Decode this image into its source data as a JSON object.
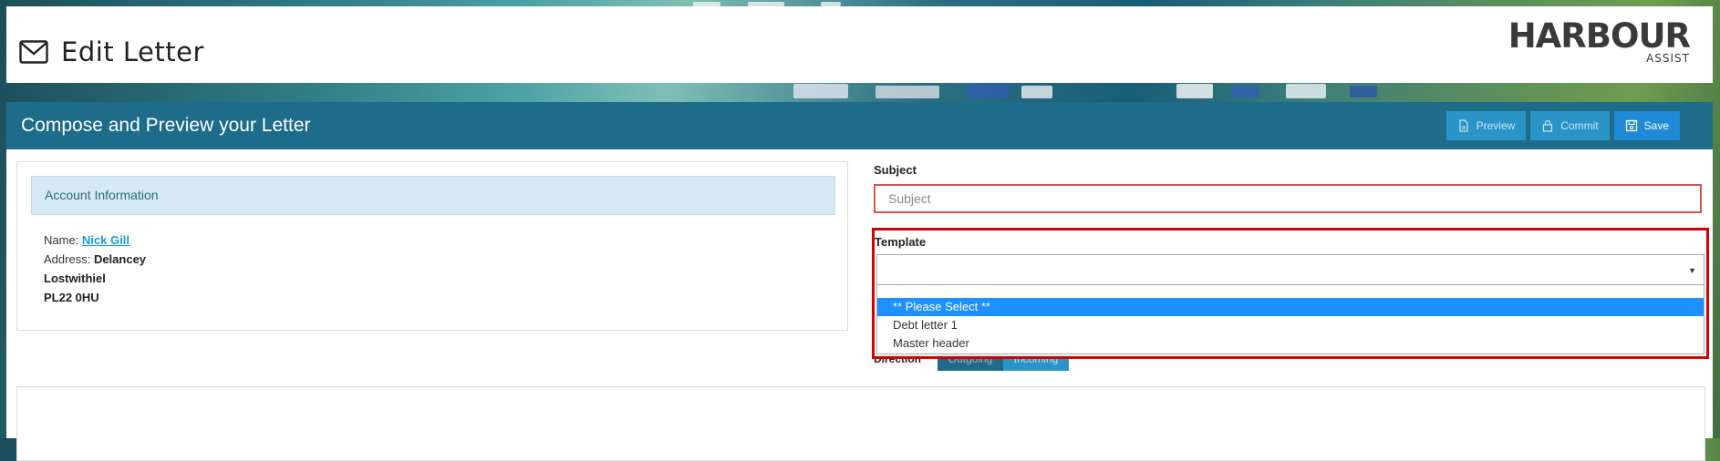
{
  "header": {
    "title": "Edit Letter",
    "logo_main": "HARBOUR",
    "logo_sub": "ASSIST"
  },
  "panel": {
    "title": "Compose and Preview your Letter",
    "buttons": {
      "preview": "Preview",
      "commit": "Commit",
      "save": "Save"
    }
  },
  "account": {
    "heading": "Account Information",
    "name_label": "Name:",
    "name_value": "Nick Gill",
    "address_label": "Address:",
    "address_line1": "Delancey",
    "address_line2": "Lostwithiel",
    "address_line3": "PL22 0HU"
  },
  "form": {
    "subject_label": "Subject",
    "subject_placeholder": "Subject",
    "subject_value": "",
    "template_label": "Template",
    "template_value": "",
    "template_options": [
      "** Please Select **",
      "Debt letter 1",
      "Master header"
    ],
    "template_highlighted": "** Please Select **",
    "direction_label": "Direction",
    "direction_options": [
      "Outgoing",
      "Incoming"
    ]
  },
  "colors": {
    "panel_bar": "#1e6b8a",
    "button_light": "#2a94c7",
    "button_save": "#1f8ad6",
    "error_border": "#d9534f",
    "highlight_frame": "#d60000",
    "option_selected": "#1e90ff",
    "link": "#1a9ad6"
  },
  "icons": {
    "title": "envelope-icon",
    "preview": "document-icon",
    "commit": "lock-icon",
    "save": "save-icon",
    "select": "caret-down-icon"
  }
}
